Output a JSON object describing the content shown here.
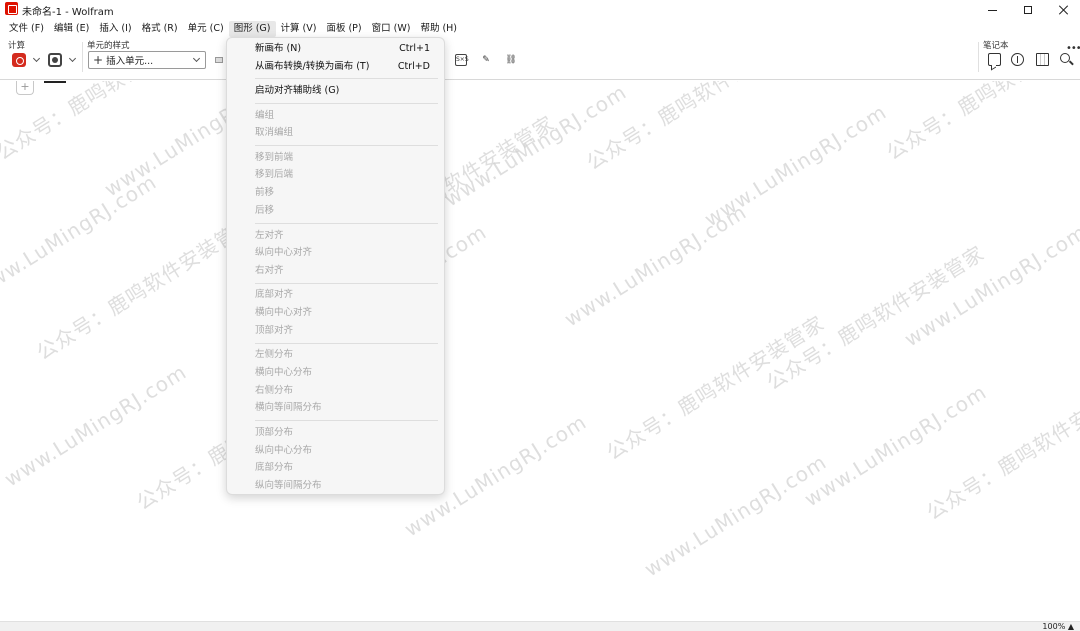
{
  "window": {
    "title": "未命名-1 - Wolfram",
    "icon": "wolfram-logo"
  },
  "menubar": [
    {
      "label": "文件 (F)"
    },
    {
      "label": "编辑 (E)"
    },
    {
      "label": "插入 (I)"
    },
    {
      "label": "格式 (R)"
    },
    {
      "label": "单元 (C)"
    },
    {
      "label": "图形 (G)",
      "active": true
    },
    {
      "label": "计算 (V)"
    },
    {
      "label": "面板 (P)"
    },
    {
      "label": "窗口 (W)"
    },
    {
      "label": "帮助 (H)"
    }
  ],
  "toolbar": {
    "compute_label": "计算",
    "cell_style_label": "单元的样式",
    "insert_cell_placeholder": "插入单元...",
    "notebook_label": "笔记本",
    "more_icon": "more-icon"
  },
  "graphics_menu": {
    "items": [
      {
        "label": "新画布 (N)",
        "shortcut": "Ctrl+1",
        "enabled": true
      },
      {
        "label": "从画布转换/转换为画布 (T)",
        "shortcut": "Ctrl+D",
        "enabled": true
      },
      {
        "label": "启动对齐辅助线 (G)",
        "enabled": true
      },
      {
        "label": "编组",
        "enabled": false
      },
      {
        "label": "取消编组",
        "enabled": false
      },
      {
        "label": "移到前端",
        "enabled": false
      },
      {
        "label": "移到后端",
        "enabled": false
      },
      {
        "label": "前移",
        "enabled": false
      },
      {
        "label": "后移",
        "enabled": false
      },
      {
        "label": "左对齐",
        "enabled": false
      },
      {
        "label": "纵向中心对齐",
        "enabled": false
      },
      {
        "label": "右对齐",
        "enabled": false
      },
      {
        "label": "底部对齐",
        "enabled": false
      },
      {
        "label": "横向中心对齐",
        "enabled": false
      },
      {
        "label": "顶部对齐",
        "enabled": false
      },
      {
        "label": "左侧分布",
        "enabled": false
      },
      {
        "label": "横向中心分布",
        "enabled": false
      },
      {
        "label": "右侧分布",
        "enabled": false
      },
      {
        "label": "横向等间隔分布",
        "enabled": false
      },
      {
        "label": "顶部分布",
        "enabled": false
      },
      {
        "label": "纵向中心分布",
        "enabled": false
      },
      {
        "label": "底部分布",
        "enabled": false
      },
      {
        "label": "纵向等间隔分布",
        "enabled": false
      }
    ]
  },
  "document": {
    "insert_cell_symbol": "+"
  },
  "statusbar": {
    "zoom": "100% ▲"
  },
  "watermark": {
    "text_a": "www.LuMingRJ.com",
    "text_b": "公众号：鹿鸣软件安装管家"
  },
  "colors": {
    "accent": "#dd1100",
    "menu_bg": "#f6f6f6",
    "disabled_text": "#a8a8a8"
  }
}
